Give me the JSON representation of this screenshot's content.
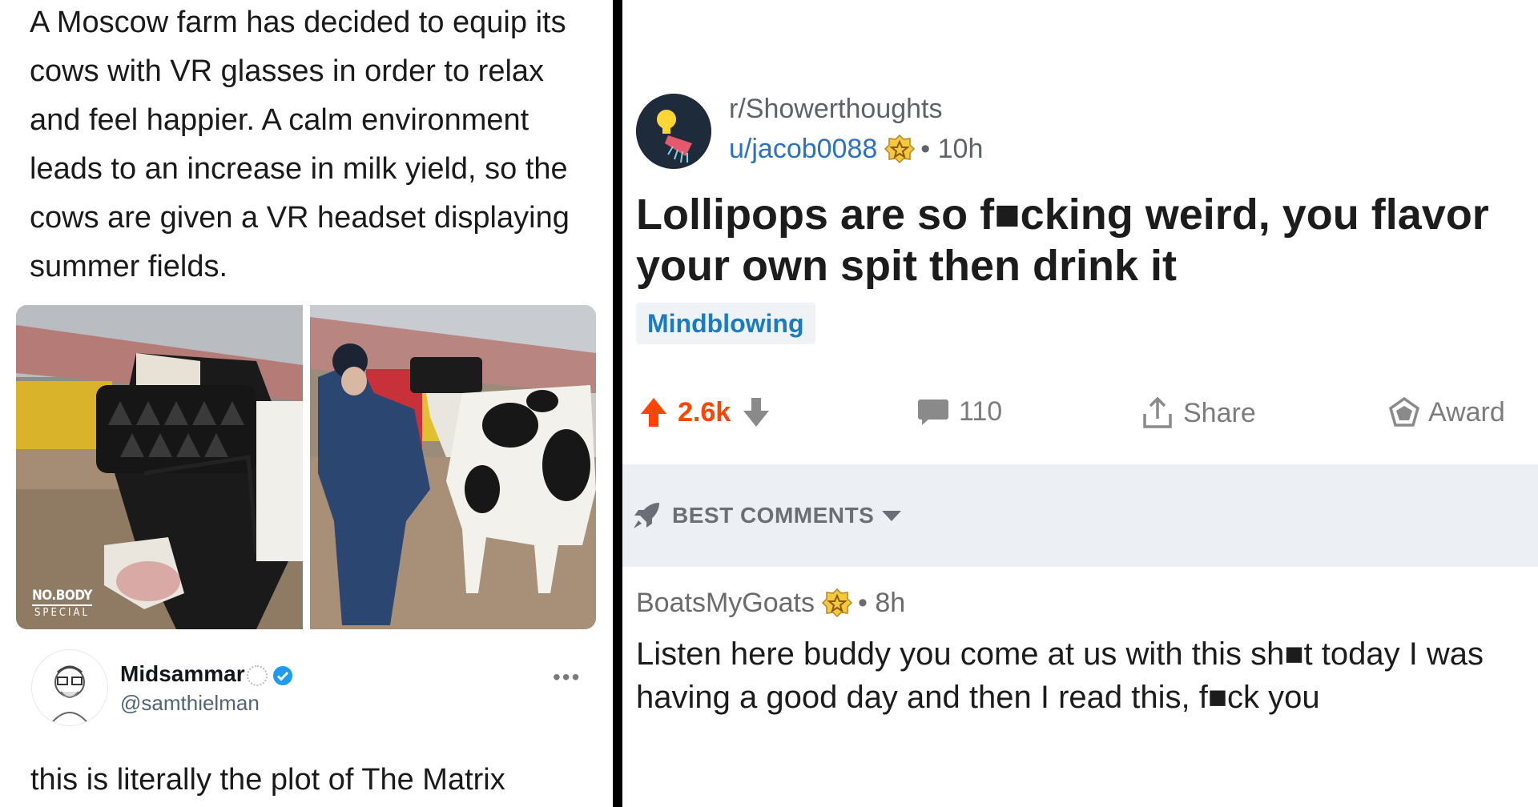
{
  "tweet": {
    "text": "A Moscow farm has decided to equip its cows with VR glasses in order to relax and feel happier. A calm environment leads to an increase in milk yield, so the cows are given a VR headset displaying summer fields.",
    "watermark_line1": "NO.BODY",
    "watermark_line2": "SPECIAL"
  },
  "reply": {
    "name": "Midsammar",
    "handle": "@samthielman",
    "text": "this is literally the plot of The Matrix"
  },
  "reddit": {
    "subreddit": "r/Showerthoughts",
    "user": "u/jacob0088",
    "separator": "•",
    "time": "10h",
    "title": "Lollipops are so f■cking weird, you flavor your own spit then drink it",
    "flair": "Mindblowing",
    "upvotes": "2.6k",
    "comments_count": "110",
    "share_label": "Share",
    "award_label": "Award",
    "sort_label": "BEST COMMENTS",
    "comment": {
      "author": "BoatsMyGoats",
      "time": "8h",
      "text": "Listen here buddy you come at us with this sh■t today I was having a good day and then I read this, f■ck you"
    }
  },
  "colors": {
    "divider": "#000000",
    "reddit_orange": "#ff4500",
    "link_blue": "#2c73bf",
    "flair_blue": "#1a7bc2",
    "verified_blue": "#1d9bf0"
  }
}
